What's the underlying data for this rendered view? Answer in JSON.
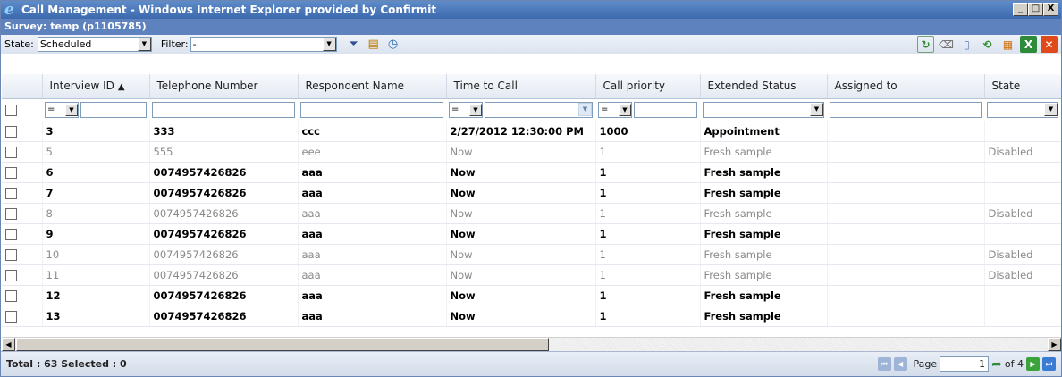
{
  "window": {
    "title": "Call Management - Windows Internet Explorer provided by Confirmit",
    "controls": [
      "_",
      "□",
      "X"
    ]
  },
  "survey": {
    "label": "Survey: temp (p1105785)"
  },
  "toolbar": {
    "state_label": "State:",
    "state_value": "Scheduled",
    "filter_label": "Filter:",
    "filter_value": "-"
  },
  "grid": {
    "columns": [
      "Interview ID",
      "Telephone Number",
      "Respondent Name",
      "Time to Call",
      "Call priority",
      "Extended Status",
      "Assigned to",
      "State"
    ],
    "sort_indicator": "▲",
    "filter_operators": {
      "interview_id": "=",
      "time_to_call": "=",
      "call_priority": "="
    },
    "rows": [
      {
        "id": "3",
        "phone": "333",
        "name": "ccc",
        "time": "2/27/2012 12:30:00 PM",
        "priority": "1000",
        "status": "Appointment",
        "assigned": "",
        "state": "",
        "disabled": false
      },
      {
        "id": "5",
        "phone": "555",
        "name": "eee",
        "time": "Now",
        "priority": "1",
        "status": "Fresh sample",
        "assigned": "",
        "state": "Disabled",
        "disabled": true
      },
      {
        "id": "6",
        "phone": "0074957426826",
        "name": "aaa",
        "time": "Now",
        "priority": "1",
        "status": "Fresh sample",
        "assigned": "",
        "state": "",
        "disabled": false
      },
      {
        "id": "7",
        "phone": "0074957426826",
        "name": "aaa",
        "time": "Now",
        "priority": "1",
        "status": "Fresh sample",
        "assigned": "",
        "state": "",
        "disabled": false
      },
      {
        "id": "8",
        "phone": "0074957426826",
        "name": "aaa",
        "time": "Now",
        "priority": "1",
        "status": "Fresh sample",
        "assigned": "",
        "state": "Disabled",
        "disabled": true
      },
      {
        "id": "9",
        "phone": "0074957426826",
        "name": "aaa",
        "time": "Now",
        "priority": "1",
        "status": "Fresh sample",
        "assigned": "",
        "state": "",
        "disabled": false
      },
      {
        "id": "10",
        "phone": "0074957426826",
        "name": "aaa",
        "time": "Now",
        "priority": "1",
        "status": "Fresh sample",
        "assigned": "",
        "state": "Disabled",
        "disabled": true
      },
      {
        "id": "11",
        "phone": "0074957426826",
        "name": "aaa",
        "time": "Now",
        "priority": "1",
        "status": "Fresh sample",
        "assigned": "",
        "state": "Disabled",
        "disabled": true
      },
      {
        "id": "12",
        "phone": "0074957426826",
        "name": "aaa",
        "time": "Now",
        "priority": "1",
        "status": "Fresh sample",
        "assigned": "",
        "state": "",
        "disabled": false
      },
      {
        "id": "13",
        "phone": "0074957426826",
        "name": "aaa",
        "time": "Now",
        "priority": "1",
        "status": "Fresh sample",
        "assigned": "",
        "state": "",
        "disabled": false
      }
    ]
  },
  "status": {
    "summary": "Total : 63 Selected : 0",
    "page_label": "Page",
    "page_value": "1",
    "of_label": "of 4"
  },
  "colors": {
    "titlebar": "#3c69ad",
    "surveybar": "#5d82bd",
    "disabled_text": "#8a8a8a",
    "pager_blue": "#3a7bd5",
    "pager_green": "#3aa33a"
  }
}
